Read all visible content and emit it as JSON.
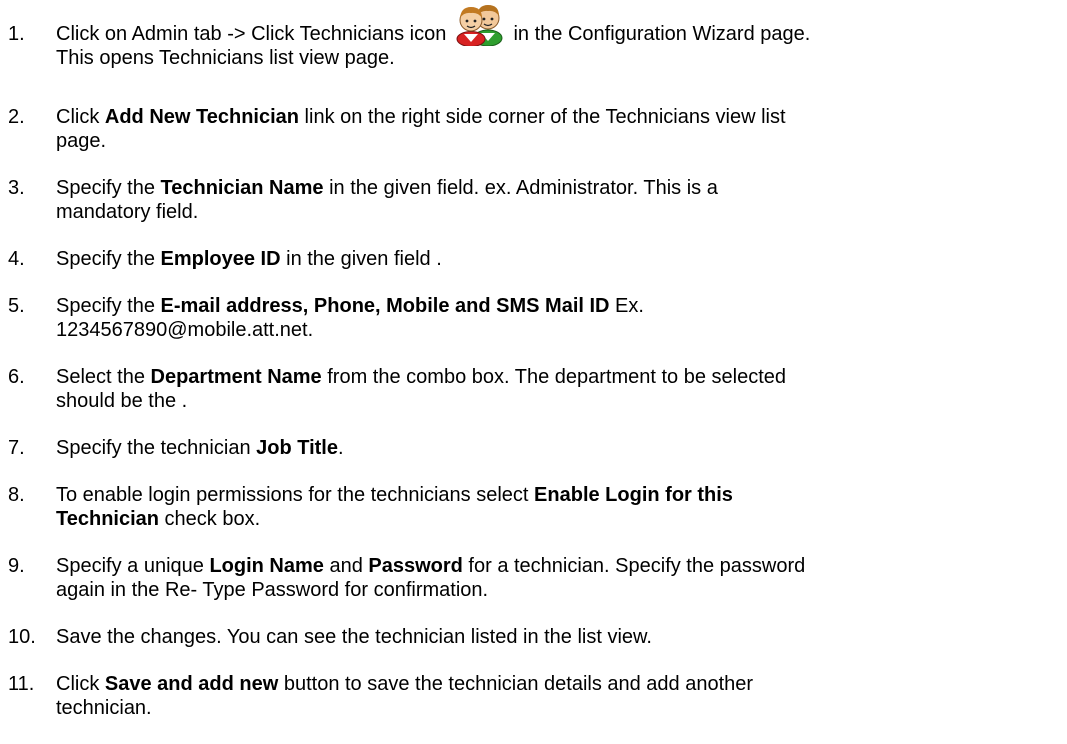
{
  "icon": "technicians-icon",
  "steps": [
    {
      "num": "1.",
      "a": "Click on Admin tab -> Click Technicians icon ",
      "b": " in the Configuration Wizard page.",
      "c": "This opens Technicians list view page."
    },
    {
      "num": "2.",
      "a": "Click ",
      "b": "Add New Technician",
      "c": " link on the right side corner of the Technicians view list",
      "d": "page."
    },
    {
      "num": "3.",
      "a": "Specify the ",
      "b": "Technician Name",
      "c": " in the given field. ex. Administrator. This is a",
      "d": "mandatory field."
    },
    {
      "num": "4.",
      "a": "Specify the ",
      "b": "Employee ID",
      "c": " in the given field ."
    },
    {
      "num": "5.",
      "a": "Specify the ",
      "b": "E-mail address, Phone, Mobile and SMS Mail ID",
      "c": " Ex.",
      "d": "1234567890@mobile.att.net."
    },
    {
      "num": "6.",
      "a": "Select the ",
      "b": "Department Name",
      "c": " from the combo box. The department to be selected",
      "d": "should be the  ."
    },
    {
      "num": "7.",
      "a": "Specify the technician ",
      "b": "Job Title",
      "c": "."
    },
    {
      "num": "8.",
      "a": "To enable login permissions for the technicians select ",
      "b": "Enable Login for this",
      "c": "Technician",
      "d": " check box."
    },
    {
      "num": "9.",
      "a": "Specify a unique ",
      "b": "Login Name",
      "c": " and ",
      "d": "Password",
      "e": " for a technician. Specify the password",
      "f": "again in the Re- Type Password for confirmation."
    },
    {
      "num": "10.",
      "a": "Save the changes. You can see the technician listed in the list view."
    },
    {
      "num": "11.",
      "a": "Click ",
      "b": "Save and add new",
      "c": " button to save the technician details and add another",
      "d": "technician."
    }
  ]
}
